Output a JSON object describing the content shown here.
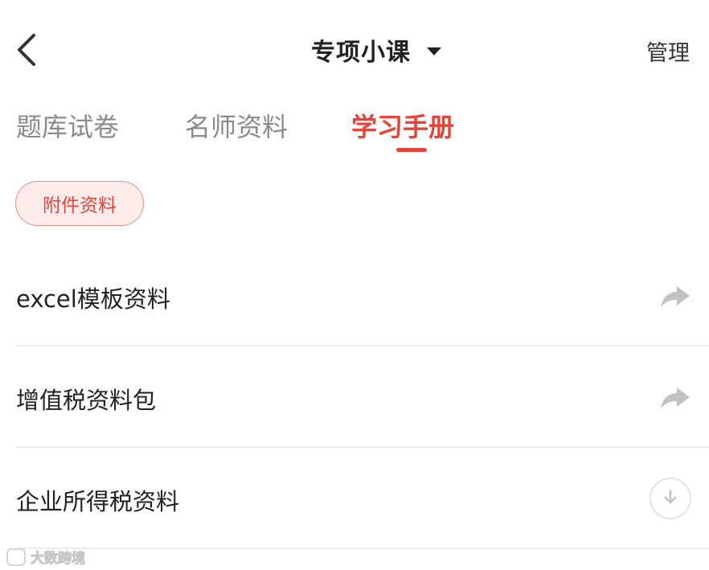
{
  "header": {
    "title": "专项小课",
    "manage_label": "管理"
  },
  "tabs": [
    {
      "label": "题库试卷",
      "active": false
    },
    {
      "label": "名师资料",
      "active": false
    },
    {
      "label": "学习手册",
      "active": true
    }
  ],
  "chip": {
    "label": "附件资料"
  },
  "list": {
    "items": [
      {
        "label": "excel模板资料",
        "icon": "share-arrow-icon"
      },
      {
        "label": "增值税资料包",
        "icon": "share-arrow-icon"
      },
      {
        "label": "企业所得税资料",
        "icon": "download-icon"
      }
    ]
  },
  "watermark": {
    "text": "大数跨境"
  },
  "colors": {
    "accent": "#e8433a",
    "chip_bg": "#fdecea",
    "text_primary": "#222222",
    "text_muted": "#8a8a8a",
    "divider": "#ececec"
  }
}
